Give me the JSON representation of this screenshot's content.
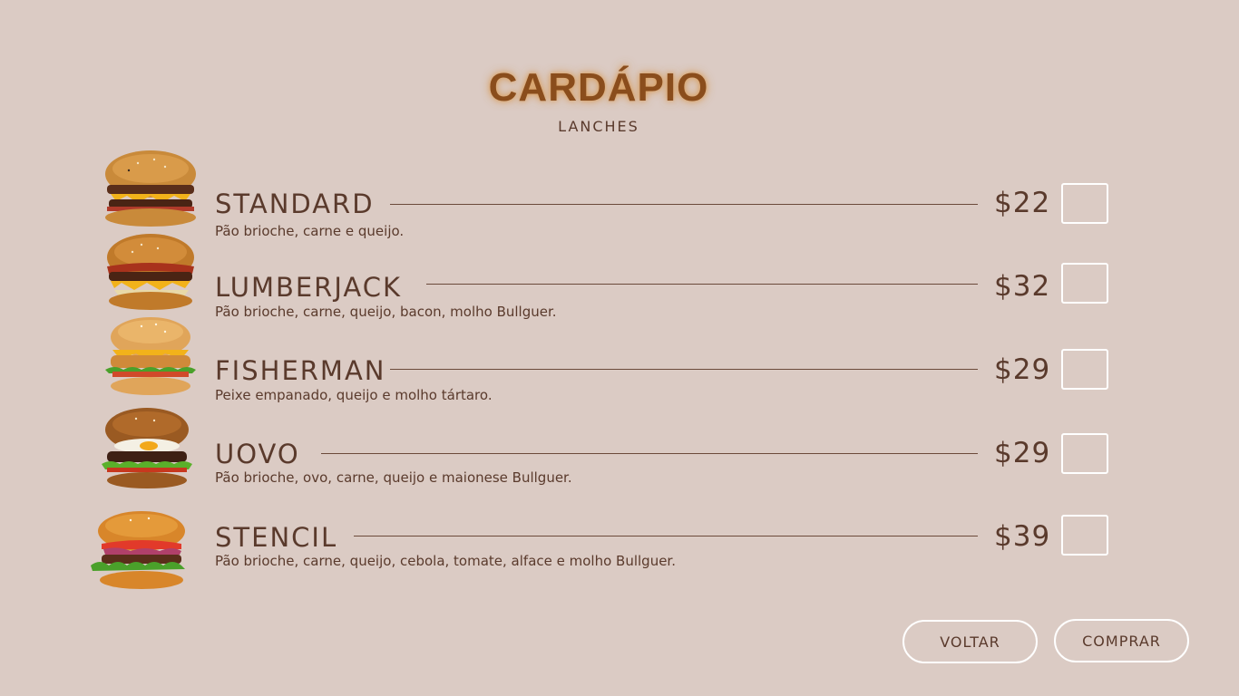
{
  "header": {
    "title": "CARDÁPIO",
    "subtitle": "LANCHES"
  },
  "items": [
    {
      "name": "STANDARD",
      "desc": "Pão brioche, carne e queijo.",
      "price": "$22"
    },
    {
      "name": "LUMBERJACK",
      "desc": "Pão brioche, carne, queijo, bacon, molho Bullguer.",
      "price": "$32"
    },
    {
      "name": "FISHERMAN",
      "desc": "Peixe empanado, queijo e molho tártaro.",
      "price": "$29"
    },
    {
      "name": "UOVO",
      "desc": "Pão brioche, ovo, carne, queijo e maionese Bullguer.",
      "price": "$29"
    },
    {
      "name": "STENCIL",
      "desc": "Pão brioche, carne, queijo, cebola, tomate, alface e molho Bullguer.",
      "price": "$39"
    }
  ],
  "buttons": {
    "back": "VOLTAR",
    "buy": "COMPRAR"
  },
  "colors": {
    "background": "#dbcbc4",
    "text": "#5a3a2c",
    "title": "#8a4d1c",
    "checkbox_border": "#ffffff"
  }
}
